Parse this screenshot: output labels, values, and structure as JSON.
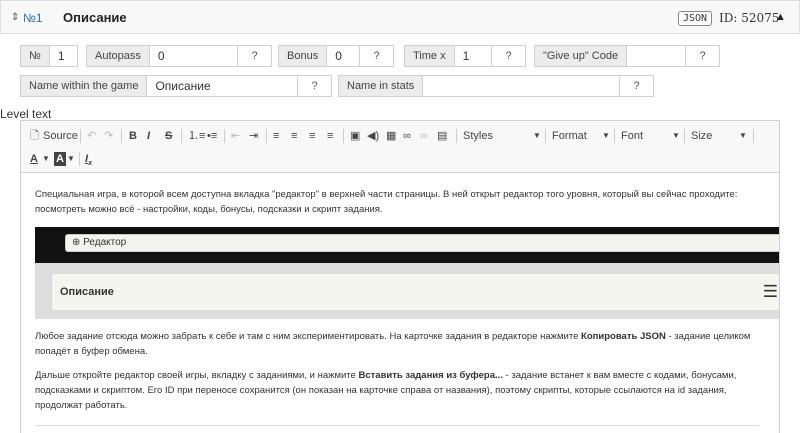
{
  "header": {
    "sort_icon": "⇕",
    "number": "№1",
    "title": "Описание",
    "json_label": "JSON",
    "id_text": "ID: 52075",
    "collapse_icon": "▲"
  },
  "params": {
    "num": {
      "label": "№",
      "value": "1"
    },
    "autopass": {
      "label": "Autopass",
      "value": "0"
    },
    "bonus": {
      "label": "Bonus",
      "value": "0"
    },
    "timex": {
      "label": "Time x",
      "value": "1"
    },
    "giveup": {
      "label": "\"Give up\" Code",
      "value": ""
    },
    "name_game": {
      "label": "Name within the game",
      "value": "Описание"
    },
    "name_stats": {
      "label": "Name in stats",
      "value": ""
    },
    "help_icon": "?"
  },
  "level_text_label": "Level text",
  "toolbar": {
    "source": "Source",
    "styles": "Styles",
    "format": "Format",
    "font": "Font",
    "size": "Size"
  },
  "content": {
    "para1": "Специальная игра, в которой всем доступна вкладка \"редактор\" в верхней части страницы. В ней открыт редактор того уровня, который вы сейчас проходите: посмотреть можно всё - настройки, коды, бонусы, подсказки и скрипт задания.",
    "shot_editor": "⊕ Редактор",
    "shot_title": "Описание",
    "para2_a": "Любое задание отсюда можно забрать к себе и там с ним экспериментировать. На карточке задания в редакторе нажмите ",
    "para2_b": "Копировать JSON",
    "para2_c": " - задание целиком попадёт в буфер обмена.",
    "para3_a": "Дальше откройте редактор своей игры, вкладку с заданиями, и нажмите ",
    "para3_b": "Вставить задания из буфера...",
    "para3_c": " - задание встанет к вам вместе с кодами, бонусами, подсказками и скриптом. Его ID при переносе сохранится (он показан на карточке справа от названия), поэтому скрипты, которые ссылаются на id задания, продолжат работать."
  }
}
